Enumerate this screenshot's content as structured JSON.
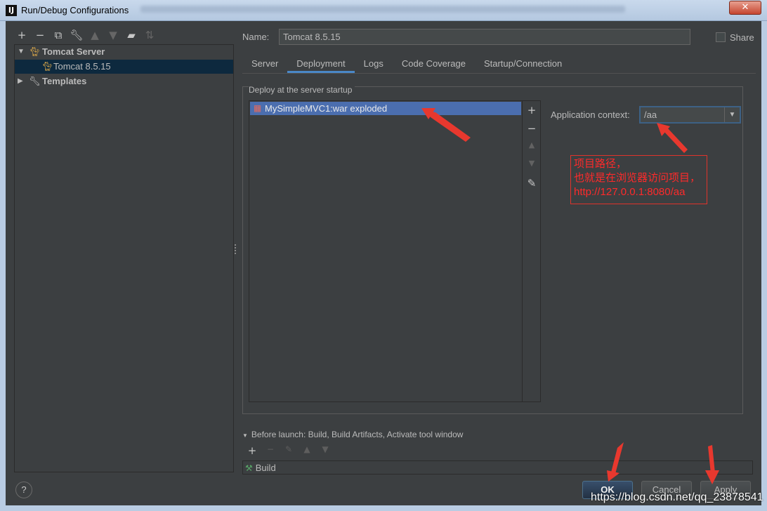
{
  "window": {
    "title": "Run/Debug Configurations",
    "app_icon": "IJ",
    "close_glyph": "✕"
  },
  "toolbar": {
    "icons": [
      "plus-icon",
      "minus-icon",
      "copy-icon",
      "wrench-icon",
      "arrow-up-icon",
      "arrow-down-icon",
      "folder-plus-icon",
      "sort-icon"
    ]
  },
  "tree": {
    "items": [
      {
        "label": "Tomcat Server",
        "icon": "tomcat-icon",
        "expanded": true
      },
      {
        "label": "Tomcat 8.5.15",
        "icon": "tomcat-icon",
        "selected": true
      },
      {
        "label": "Templates",
        "icon": "wrench-icon",
        "expanded": false
      }
    ]
  },
  "config": {
    "name_label": "Name:",
    "name_value": "Tomcat 8.5.15",
    "share_label": "Share"
  },
  "tabs": [
    "Server",
    "Deployment",
    "Logs",
    "Code Coverage",
    "Startup/Connection"
  ],
  "active_tab": "Deployment",
  "deployment": {
    "section_title": "Deploy at the server startup",
    "items": [
      "MySimpleMVC1:war exploded"
    ],
    "context_label": "Application context:",
    "context_value": "/aa"
  },
  "annotation": {
    "line1": "项目路径，",
    "line2": "也就是在浏览器访问项目，",
    "line3": "http://127.0.0.1:8080/aa",
    "color": "#ff2a2a"
  },
  "before_launch": {
    "title": "Before launch: Build, Build Artifacts, Activate tool window",
    "items": [
      "Build"
    ]
  },
  "buttons": {
    "help": "?",
    "ok": "OK",
    "cancel": "Cancel",
    "apply": "Apply"
  },
  "watermark": "https://blog.csdn.net/qq_23878541",
  "colors": {
    "background": "#3c3f41",
    "selection": "#4b6eaf",
    "tree_selection": "#0d293e",
    "tab_underline": "#4a88c7",
    "annotation_red": "#e0332b"
  }
}
